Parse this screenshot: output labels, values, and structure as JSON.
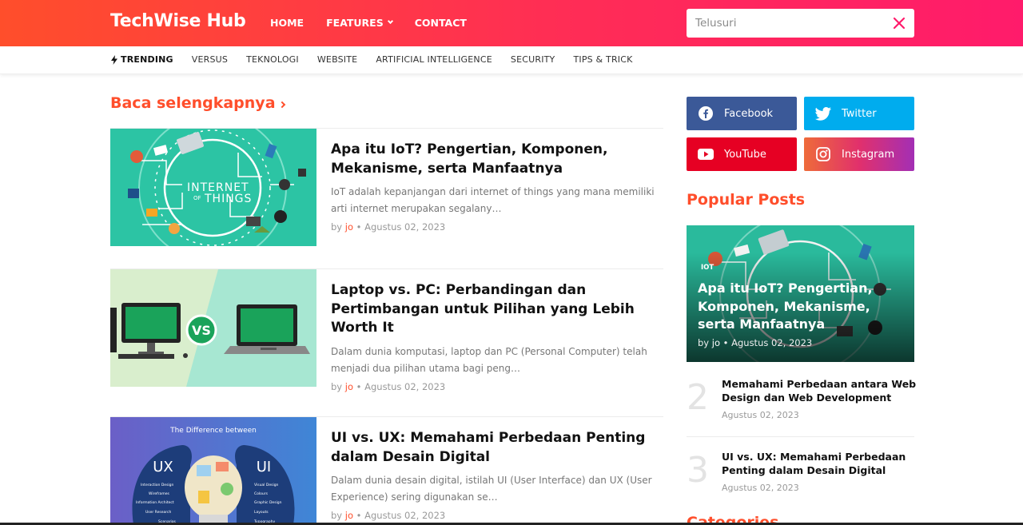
{
  "site": {
    "logo": "TechWise Hub"
  },
  "nav": {
    "items": [
      "HOME",
      "FEATURES",
      "CONTACT"
    ]
  },
  "search": {
    "placeholder": "Telusuri"
  },
  "subnav": {
    "trending": "TRENDING",
    "items": [
      "VERSUS",
      "TEKNOLOGI",
      "WEBSITE",
      "ARTIFICIAL INTELLIGENCE",
      "SECURITY",
      "TIPS & TRICK"
    ]
  },
  "main": {
    "section_title": "Baca selengkapnya",
    "posts": [
      {
        "title": "Apa itu IoT? Pengertian, Komponen, Mekanisme, serta Manfaatnya",
        "excerpt": "IoT adalah kepanjangan dari internet of things yang mana memiliki arti internet merupakan segalany…",
        "by": "by",
        "author": "jo",
        "sep": "•",
        "date": "Agustus 02, 2023",
        "thumb_text": [
          "INTERNET",
          "OF",
          "THINGS"
        ]
      },
      {
        "title": "Laptop vs. PC: Perbandingan dan Pertimbangan untuk Pilihan yang Lebih Worth It",
        "excerpt": "Dalam dunia komputasi, laptop dan PC (Personal Computer) telah menjadi dua pilihan utama bagi peng…",
        "by": "by",
        "author": "jo",
        "sep": "•",
        "date": "Agustus 02, 2023",
        "thumb_text": [
          "VS"
        ]
      },
      {
        "title": "UI vs. UX: Memahami Perbedaan Penting dalam Desain Digital",
        "excerpt": "Dalam dunia desain digital, istilah UI (User Interface) dan UX (User Experience) sering digunakan se…",
        "by": "by",
        "author": "jo",
        "sep": "•",
        "date": "Agustus 02, 2023",
        "thumb_text": [
          "The Difference between",
          "UX",
          "UI",
          "Interaction Design",
          "Wireframes",
          "Information Architect",
          "User Research",
          "Scenarios",
          "Visual Design",
          "Colours",
          "Graphic Design",
          "Layouts",
          "Typography"
        ]
      }
    ]
  },
  "sidebar": {
    "social": [
      {
        "label": "Facebook",
        "icon": "facebook-icon",
        "color": "#3b5998"
      },
      {
        "label": "Twitter",
        "icon": "twitter-icon",
        "color": "#00acee"
      },
      {
        "label": "YouTube",
        "icon": "youtube-icon",
        "color": "#e60023"
      },
      {
        "label": "Instagram",
        "icon": "instagram-icon",
        "color": "#d6249f"
      }
    ],
    "popular_title": "Popular Posts",
    "popular_big": {
      "badge": "IOT",
      "title": "Apa itu IoT? Pengertian, Komponen, Mekanisme, serta Manfaatnya",
      "by": "by",
      "author": "jo",
      "sep": "•",
      "date": "Agustus 02, 2023"
    },
    "popular_list": [
      {
        "num": "2",
        "title": "Memahami Perbedaan antara Web Design dan Web Development",
        "date": "Agustus 02, 2023"
      },
      {
        "num": "3",
        "title": "UI vs. UX: Memahami Perbedaan Penting dalam Desain Digital",
        "date": "Agustus 02, 2023"
      }
    ],
    "categories_title": "Categories"
  },
  "colors": {
    "accent": "#ff4e2b",
    "header_gradient_end": "#ff1b6b"
  }
}
